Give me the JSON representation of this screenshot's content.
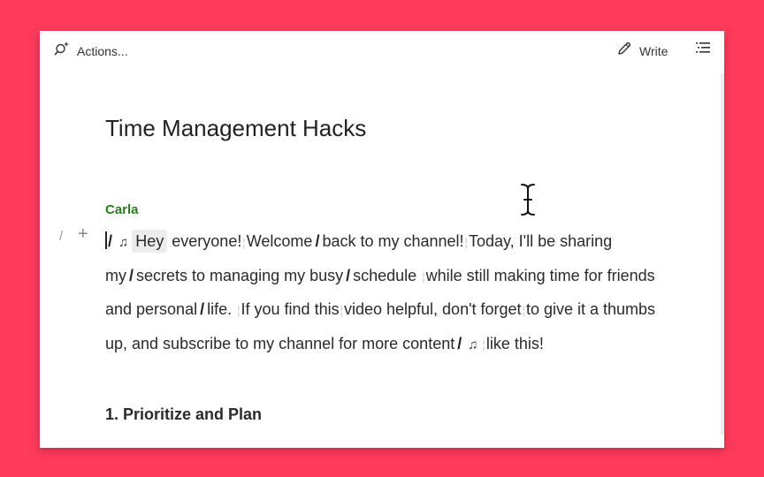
{
  "toolbar": {
    "actions_label": "Actions...",
    "write_label": "Write",
    "actions_icon": "ai-sparkle-search-icon",
    "write_icon": "pencil-icon",
    "outline_icon": "list-outline-icon"
  },
  "document": {
    "title": "Time Management Hacks",
    "speaker": "Carla",
    "gutter": {
      "slash": "/",
      "plus": "+"
    },
    "paragraph": {
      "segments": [
        {
          "type": "cursor"
        },
        {
          "type": "slash",
          "text": "/"
        },
        {
          "type": "note",
          "text": "♫"
        },
        {
          "type": "highlight",
          "text": "Hey"
        },
        {
          "type": "text",
          "text": " everyone!"
        },
        {
          "type": "sep",
          "text": "¦"
        },
        {
          "type": "text",
          "text": "Welcome"
        },
        {
          "type": "slash",
          "text": "/"
        },
        {
          "type": "text",
          "text": "back to my channel!"
        },
        {
          "type": "sep",
          "text": "¦"
        },
        {
          "type": "text",
          "text": "Today, I'll be sharing my"
        },
        {
          "type": "slash",
          "text": "/"
        },
        {
          "type": "text",
          "text": "secrets to managing my busy"
        },
        {
          "type": "slash",
          "text": "/"
        },
        {
          "type": "text",
          "text": "schedule "
        },
        {
          "type": "sep",
          "text": "¦"
        },
        {
          "type": "text",
          "text": "while still making time for friends and personal"
        },
        {
          "type": "slash",
          "text": "/"
        },
        {
          "type": "text",
          "text": "life. "
        },
        {
          "type": "sep",
          "text": "¦"
        },
        {
          "type": "text",
          "text": "If you find this"
        },
        {
          "type": "sep",
          "text": "¦"
        },
        {
          "type": "text",
          "text": "video helpful, don't forget"
        },
        {
          "type": "sep",
          "text": "¦"
        },
        {
          "type": "text",
          "text": "to give it a thumbs up, and subscribe to my channel for more content"
        },
        {
          "type": "slash",
          "text": "/"
        },
        {
          "type": "note",
          "text": "♫"
        },
        {
          "type": "sep",
          "text": "¦"
        },
        {
          "type": "text",
          "text": "like this!"
        }
      ]
    },
    "section_heading": "1. Prioritize and Plan"
  },
  "colors": {
    "background": "#ff3b5c",
    "speaker": "#2b7a1f",
    "highlight": "#ececec"
  }
}
